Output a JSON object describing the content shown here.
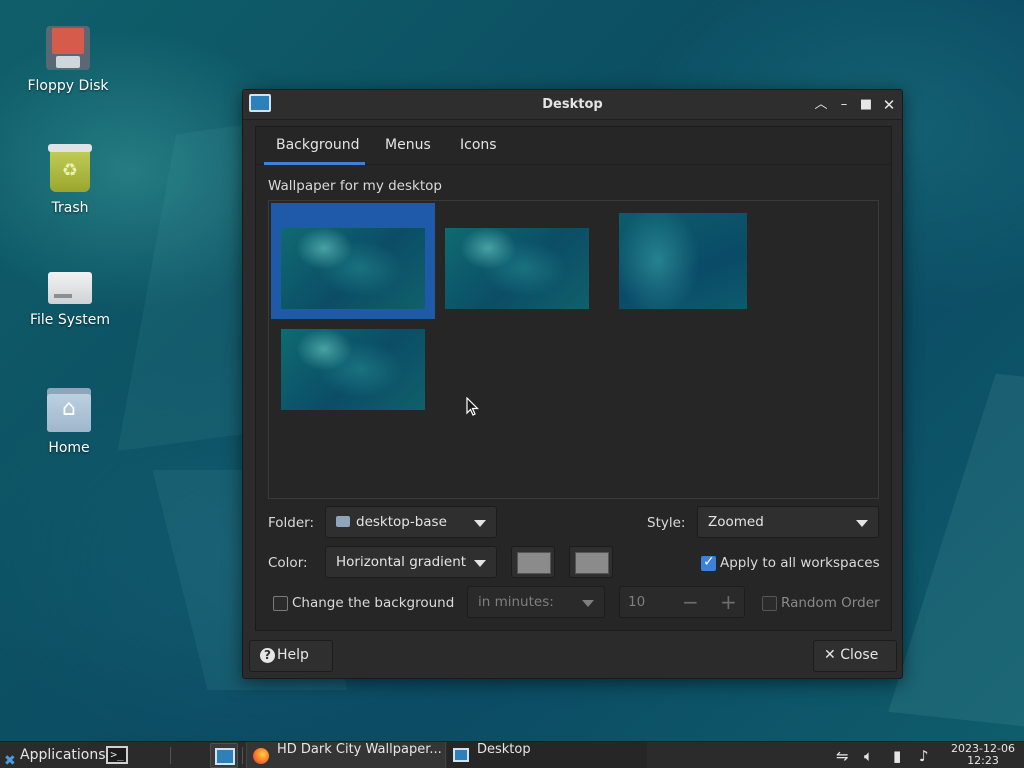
{
  "desktop": {
    "icons": [
      {
        "label": "Floppy Disk",
        "icon": "floppy-disk-icon"
      },
      {
        "label": "Trash",
        "icon": "trash-icon"
      },
      {
        "label": "File System",
        "icon": "drive-icon"
      },
      {
        "label": "Home",
        "icon": "home-folder-icon"
      }
    ]
  },
  "window": {
    "title": "Desktop",
    "tabs": [
      {
        "label": "Background",
        "active": true
      },
      {
        "label": "Menus",
        "active": false
      },
      {
        "label": "Icons",
        "active": false
      }
    ],
    "wallpaper_label": "Wallpaper for my desktop",
    "thumbnails_count": 4,
    "selected_thumbnail": 1,
    "folder": {
      "label": "Folder:",
      "value": "desktop-base"
    },
    "style": {
      "label": "Style:",
      "value": "Zoomed"
    },
    "color": {
      "label": "Color:",
      "value": "Horizontal gradient",
      "swatch1": "#8b8b8b",
      "swatch2": "#8b8b8b"
    },
    "apply_all": {
      "label": "Apply to all workspaces",
      "checked": true
    },
    "change_bg": {
      "label": "Change the background",
      "checked": false
    },
    "interval": {
      "value": "in minutes:"
    },
    "minutes": {
      "value": "10",
      "minus": "−",
      "plus": "+"
    },
    "random_order": {
      "label": "Random Order",
      "checked": false
    },
    "help_label": "Help",
    "close_label": "Close"
  },
  "taskbar": {
    "applications_label": "Applications",
    "tasks": [
      {
        "label": "HD Dark City Wallpaper...",
        "icon": "firefox-icon"
      },
      {
        "label": "Desktop",
        "icon": "desktop-settings-icon"
      }
    ],
    "clock_date": "2023-12-06",
    "clock_time": "12:23"
  },
  "colors": {
    "accent": "#3d82d8",
    "window_bg": "#2b2b2b"
  }
}
